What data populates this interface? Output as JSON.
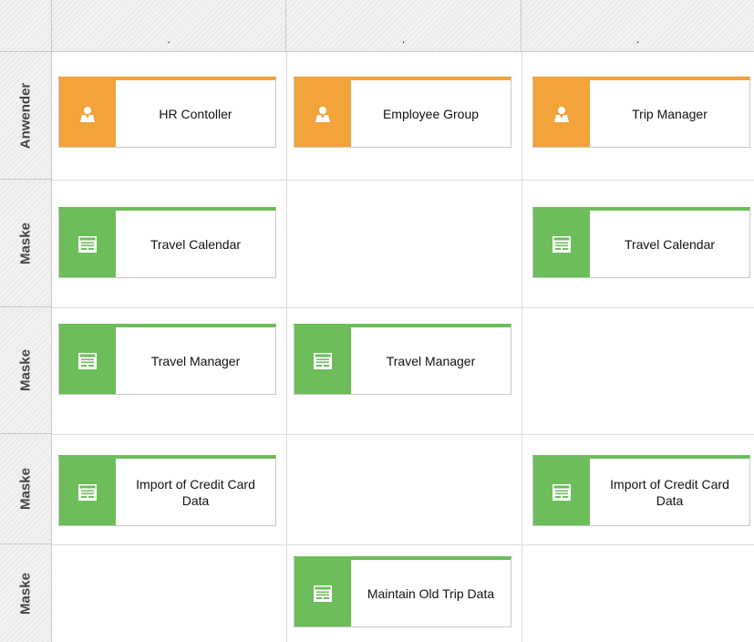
{
  "columns": [
    ".",
    ".",
    "."
  ],
  "rows": [
    "Anwender",
    "Maske",
    "Maske",
    "Maske",
    "Maske"
  ],
  "colors": {
    "person": "#f2a33a",
    "screen": "#6dbd5b",
    "grid": "#dcdcdc"
  },
  "icons": {
    "person": "person-icon",
    "screen": "screen-icon"
  },
  "objects": {
    "hr_controller": "HR Contoller",
    "employee_group": "Employee Group",
    "trip_manager": "Trip Manager",
    "travel_calendar_1": "Travel Calendar",
    "travel_calendar_2": "Travel Calendar",
    "travel_manager_1": "Travel Manager",
    "travel_manager_2": "Travel Manager",
    "import_credit_1": "Import of Credit Card Data",
    "import_credit_2": "Import of Credit Card Data",
    "maintain_old_trip": "Maintain Old Trip Data"
  }
}
